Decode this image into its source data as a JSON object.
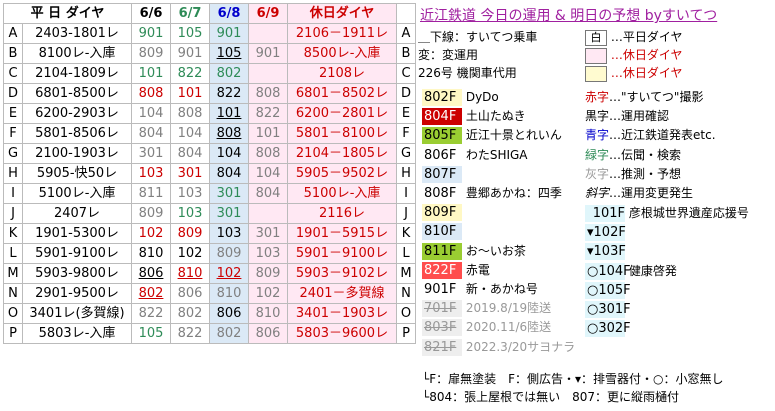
{
  "header": {
    "trip_col": "平 日 ダイヤ",
    "d1": "6/6",
    "d2": "6/7",
    "d3": "6/8",
    "d4": "6/9",
    "holiday": "休日ダイヤ"
  },
  "rows": [
    {
      "l": "A",
      "t": "2403-1801レ",
      "v1": "901",
      "v2": "105",
      "v3": "901",
      "v4": "",
      "h": "2106－1911レ",
      "r": "A"
    },
    {
      "l": "B",
      "t": "8100レ-入庫",
      "v1": "809",
      "v2": "901",
      "v3": "105",
      "v4": "901",
      "h": "8500レ-入庫",
      "r": "B"
    },
    {
      "l": "C",
      "t": "2104-1809レ",
      "v1": "101",
      "v2": "822",
      "v3": "802",
      "v4": "",
      "h": "2108レ",
      "r": "C"
    },
    {
      "l": "D",
      "t": "6801-8500レ",
      "v1": "808",
      "v2": "101",
      "v3": "822",
      "v4": "808",
      "h": "6801－8502レ",
      "r": "D"
    },
    {
      "l": "E",
      "t": "6200-2903レ",
      "v1": "104",
      "v2": "808",
      "v3": "101",
      "v4": "822",
      "h": "6200－2801レ",
      "r": "E"
    },
    {
      "l": "F",
      "t": "5801-8506レ",
      "v1": "804",
      "v2": "104",
      "v3": "808",
      "v4": "101",
      "h": "5801－8100レ",
      "r": "F"
    },
    {
      "l": "G",
      "t": "2100-1903レ",
      "v1": "301",
      "v2": "804",
      "v3": "104",
      "v4": "808",
      "h": "2104－1805レ",
      "r": "G"
    },
    {
      "l": "H",
      "t": "5905-快50レ",
      "v1": "103",
      "v2": "301",
      "v3": "804",
      "v4": "104",
      "h": "5905－9502レ",
      "r": "H"
    },
    {
      "l": "I",
      "t": "5100レ-入庫",
      "v1": "811",
      "v2": "103",
      "v3": "301",
      "v4": "804",
      "h": "5100レ-入庫",
      "r": "I"
    },
    {
      "l": "J",
      "t": "2407レ",
      "v1": "809",
      "v2": "103",
      "v3": "301",
      "v4": "",
      "h": "2116レ",
      "r": "J"
    },
    {
      "l": "K",
      "t": "1901-5300レ",
      "v1": "102",
      "v2": "809",
      "v3": "103",
      "v4": "301",
      "h": "1901－5915レ",
      "r": "K"
    },
    {
      "l": "L",
      "t": "5901-9100レ",
      "v1": "810",
      "v2": "102",
      "v3": "809",
      "v4": "103",
      "h": "5901－9100レ",
      "r": "L"
    },
    {
      "l": "M",
      "t": "5903-9800レ",
      "v1": "806",
      "v2": "810",
      "v3": "102",
      "v4": "809",
      "h": "5903－9102レ",
      "r": "M"
    },
    {
      "l": "N",
      "t": "2901-9500レ",
      "v1": "802",
      "v2": "806",
      "v3": "810",
      "v4": "102",
      "h": "2401－多賀線",
      "r": "N"
    },
    {
      "l": "O",
      "t": "3401レ(多賀線)",
      "v1": "822",
      "v2": "802",
      "v3": "806",
      "v4": "810",
      "h": "3401－1903レ",
      "r": "O"
    },
    {
      "l": "P",
      "t": "5803レ-入庫",
      "v1": "105",
      "v2": "822",
      "v3": "802",
      "v4": "806",
      "h": "5803－9600レ",
      "r": "P"
    }
  ],
  "right": {
    "title": "近江鉄道 今日の運用 & 明日の予想 byすいてつ",
    "under": "＿下線：すいてつ乗車",
    "hen": "変：変運用",
    "no226": "226号 機関車代用",
    "shiro": "白",
    "heijitsu": "…平日ダイヤ",
    "kyujitsu1": "…休日ダイヤ",
    "kyujitsu2": "…休日ダイヤ",
    "items": [
      {
        "no": "802F",
        "name": "DyDo"
      },
      {
        "no": "804F",
        "name": "土山たぬき"
      },
      {
        "no": "805F",
        "name": "近江十景とれいん"
      },
      {
        "no": "806F",
        "name": "わたSHIGA"
      },
      {
        "no": "807F",
        "name": ""
      },
      {
        "no": "808F",
        "name": "豊郷あかね：四季"
      },
      {
        "no": "809F",
        "name": ""
      },
      {
        "no": "810F",
        "name": ""
      },
      {
        "no": "811F",
        "name": "お〜いお茶"
      },
      {
        "no": "822F",
        "name": "赤電"
      },
      {
        "no": "901F",
        "name": "新・あかね号"
      },
      {
        "no": "701F",
        "name": "2019.8/19陸送"
      },
      {
        "no": "803F",
        "name": "2020.11/6陸送"
      },
      {
        "no": "821F",
        "name": "2022.3/20サヨナラ"
      }
    ],
    "keys": [
      {
        "k": "赤字",
        "v": "…\"すいてつ\"撮影"
      },
      {
        "k": "黒字",
        "v": "…運用確認"
      },
      {
        "k": "青字",
        "v": "…近江鉄道発表etc."
      },
      {
        "k": "緑字",
        "v": "…伝聞・検索"
      },
      {
        "k": "灰字",
        "v": "…推測・予想"
      },
      {
        "k": "斜字",
        "v": "…運用変更発生"
      }
    ],
    "small": [
      {
        "no": "101F",
        "name": "彦根城世界遺産応援号"
      },
      {
        "no": "▾102F",
        "name": ""
      },
      {
        "no": "▾103F",
        "name": ""
      },
      {
        "no": "○104F",
        "name": "健康啓発"
      },
      {
        "no": "○105F",
        "name": ""
      },
      {
        "no": "○301F",
        "name": ""
      },
      {
        "no": "○302F",
        "name": ""
      }
    ],
    "note1": "└F：扉無塗装　F：側広告・▾：排雪器付・○：小窓無し",
    "note2": "└804：張上屋根では無い　807：更に縦雨樋付"
  },
  "colors": {
    "holiday_bg": "#ffe8f3",
    "day68_bg": "#dbe9f6",
    "green": "#2e8b57",
    "red": "#cc0000",
    "blue": "#0000cc",
    "purple": "#a020a0"
  }
}
